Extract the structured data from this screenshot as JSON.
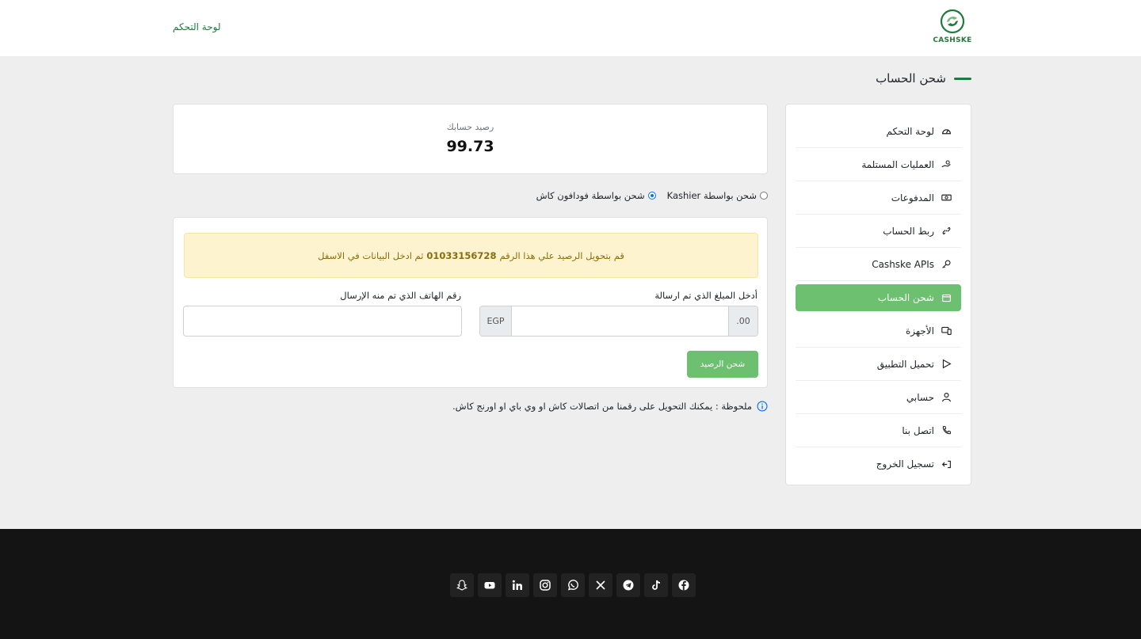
{
  "header": {
    "logo_text": "CASHSKE",
    "dashboard_link": "لوحة التحكم"
  },
  "page": {
    "title": "شحن الحساب"
  },
  "sidebar": {
    "items": [
      {
        "label": "لوحة التحكم",
        "icon": "speedometer-icon"
      },
      {
        "label": "العمليات المستلمة",
        "icon": "hand-coin-icon"
      },
      {
        "label": "المدفوعات",
        "icon": "cash-icon"
      },
      {
        "label": "ربط الحساب",
        "icon": "link-icon"
      },
      {
        "label": "Cashske APIs",
        "icon": "key-icon"
      },
      {
        "label": "شحن الحساب",
        "icon": "wallet-icon",
        "active": true
      },
      {
        "label": "الأجهزة",
        "icon": "devices-icon"
      },
      {
        "label": "تحميل التطبيق",
        "icon": "play-icon"
      },
      {
        "label": "حسابي",
        "icon": "user-icon"
      },
      {
        "label": "اتصل بنا",
        "icon": "phone-icon"
      },
      {
        "label": "تسجيل الخروج",
        "icon": "logout-icon"
      }
    ]
  },
  "balance": {
    "label": "رصيد حسابك",
    "value": "99.73"
  },
  "charge_methods": {
    "kashier": "شحن بواسطة Kashier",
    "vodafone": "شحن بواسطة فودافون كاش",
    "selected": "vodafone"
  },
  "form": {
    "alert_prefix": "قم بتحويل الرصيد علي هذا الرقم",
    "alert_number": "01033156728",
    "alert_suffix": "ثم ادخل البيانات في الاسفل",
    "amount_label": "أدخل المبلغ الذي تم ارسالة",
    "amount_value": "",
    "amount_suffix": ".00",
    "currency": "EGP",
    "phone_label": "رقم الهاتف الذي تم منه الإرسال",
    "phone_value": "",
    "submit_label": "شحن الرصيد"
  },
  "note": {
    "text": "ملحوظة : يمكنك التحويل على رقمنا من اتصالات كاش او وي باي او اورنج كاش."
  },
  "footer": {
    "social": [
      "snapchat-icon",
      "youtube-icon",
      "linkedin-icon",
      "instagram-icon",
      "whatsapp-icon",
      "x-icon",
      "telegram-icon",
      "tiktok-icon",
      "facebook-icon"
    ]
  },
  "colors": {
    "brand_green": "#1f7a3c",
    "button_green": "#6cc070",
    "alert_bg": "#fdf3cf",
    "footer_bg": "#141414"
  }
}
